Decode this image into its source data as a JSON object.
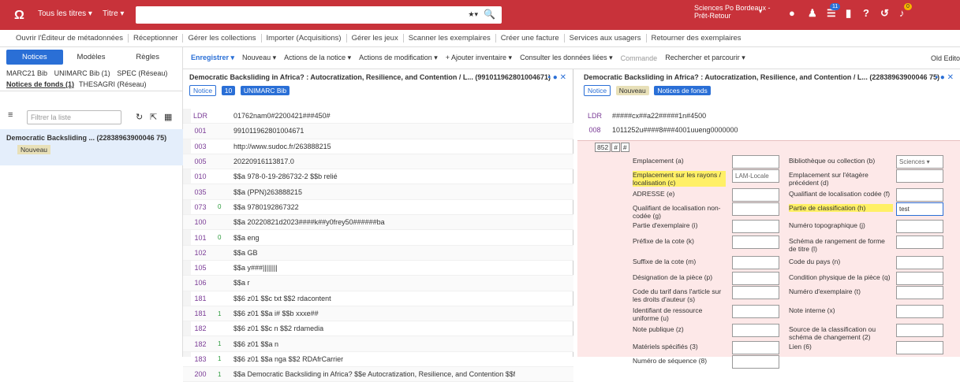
{
  "topbar": {
    "logo": "Ω",
    "scope": "Tous les titres ▾",
    "field": "Titre ▾",
    "search_value": "",
    "favorites": "★▾",
    "institution_line1": "Sciences Po Bordeaux -",
    "institution_line2": "Prêt-Retour",
    "dropdown": "▾",
    "task_badge": "11",
    "notif_badge": "0"
  },
  "menu": [
    "Ouvrir l'Éditeur de métadonnées",
    "Réceptionner",
    "Gérer les collections",
    "Importer (Acquisitions)",
    "Gérer les jeux",
    "Scanner les exemplaires",
    "Créer une facture",
    "Services aux usagers",
    "Retourner des exemplaires"
  ],
  "left": {
    "tabs": [
      "Notices",
      "Modèles",
      "Règles"
    ],
    "row1": [
      "MARC21 Bib",
      "UNIMARC Bib (1)",
      "SPEC (Réseau)"
    ],
    "row2a": "Notices de fonds (1)",
    "row2b": "THESAGRI (Réseau)",
    "filter_placeholder": "Filtrer la liste",
    "card_title": "Democratic Backsliding ... (22838963900046 75)",
    "card_status": "Nouveau"
  },
  "toolbar": [
    "Enregistrer ▾",
    "Nouveau ▾",
    "Actions de la notice ▾",
    "Actions de modification ▾",
    "+ Ajouter inventaire ▾",
    "Consulter les données liées ▾",
    "Commande",
    "Rechercher et parcourir ▾",
    "Old Edito"
  ],
  "mid": {
    "title": "Democratic Backsliding in Africa? : Autocratization, Resilience, and Contention / L...  (991011962801004671)",
    "pill_notice": "Notice",
    "pill_count": "10",
    "pill_type": "UNIMARC Bib",
    "rows": [
      [
        "LDR",
        "",
        "01762nam0#2200421###450#"
      ],
      [
        "001",
        "",
        "991011962801004671"
      ],
      [
        "003",
        "",
        "http://www.sudoc.fr/263888215"
      ],
      [
        "005",
        "",
        "20220916113817.0"
      ],
      [
        "010",
        "",
        "$$a 978-0-19-286732-2 $$b relié"
      ],
      [
        "035",
        "",
        "$$a (PPN)263888215"
      ],
      [
        "073",
        "0",
        "$$a 9780192867322"
      ],
      [
        "100",
        "",
        "$$a 20220821d2023####k##y0frey50######ba"
      ],
      [
        "101",
        "0",
        "$$a eng"
      ],
      [
        "102",
        "",
        "$$a GB"
      ],
      [
        "105",
        "",
        "$$a y###||||||||"
      ],
      [
        "106",
        "",
        "$$a r"
      ],
      [
        "181",
        "",
        "$$6 z01 $$c txt $$2 rdacontent"
      ],
      [
        "181",
        "1",
        "$$6 z01 $$a i# $$b xxxe##"
      ],
      [
        "182",
        "",
        "$$6 z01 $$c n $$2 rdamedia"
      ],
      [
        "182",
        "1",
        "$$6 z01 $$a n"
      ],
      [
        "183",
        "1",
        "$$6 z01 $$a nga $$2 RDAfrCarrier"
      ],
      [
        "200",
        "1",
        "$$a Democratic Backsliding in Africa? $$e Autocratization, Resilience, and Contention $$f"
      ]
    ]
  },
  "right": {
    "title": "Democratic Backsliding in Africa? : Autocratization, Resilience, and Contention / L...  (22838963900046 75)",
    "pill_notice": "Notice",
    "pill_new": "Nouveau",
    "pill_holdings": "Notices de fonds",
    "ldr": [
      "LDR",
      "#####cx##a22#####1n#4500"
    ],
    "f008": [
      "008",
      "1011252u####8###4001uueng0000000"
    ],
    "tag": "852",
    "ind1": "#",
    "ind2": "#",
    "left_fields": [
      "Emplacement (a)",
      "Emplacement sur les rayons / localisation (c)",
      "ADRESSE (e)",
      "Qualifiant de localisation non-codée (g)",
      "Partie d'exemplaire (i)",
      "Préfixe de la cote (k)",
      "Suffixe de la cote (m)",
      "Désignation de la pièce (p)",
      "Code du tarif dans l'article sur les droits d'auteur (s)",
      "Identifiant de ressource uniforme (u)",
      "Note publique (z)",
      "Matériels spécifiés (3)",
      "Numéro de séquence (8)"
    ],
    "right_fields": [
      "Bibliothèque ou collection (b)",
      "Emplacement sur l'étagère précédent (d)",
      "Qualifiant de localisation codée (f)",
      "Partie de classification (h)",
      "Numéro topographique (j)",
      "Schéma de rangement de forme de titre (l)",
      "Code du pays (n)",
      "Condition physique de la pièce (q)",
      "Numéro d'exemplaire (t)",
      "Note interne (x)",
      "Source de la classification ou schéma de changement (2)",
      "Lien (6)"
    ],
    "library_value": "Sciences ▾",
    "location_value": "LAM-Locale",
    "classification_value": "test"
  }
}
